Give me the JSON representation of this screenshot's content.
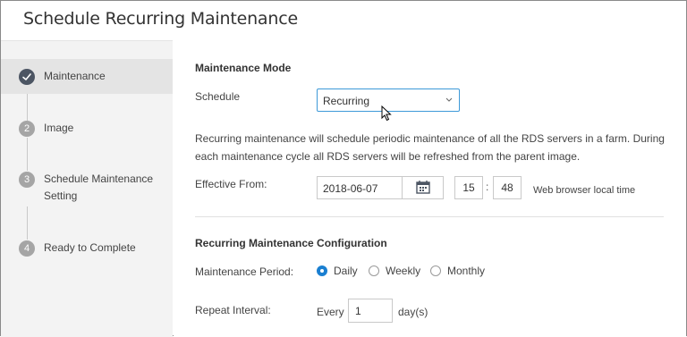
{
  "dialog": {
    "title": "Schedule Recurring Maintenance"
  },
  "steps": [
    {
      "number": "",
      "label": "Maintenance",
      "state": "active"
    },
    {
      "number": "2",
      "label": "Image",
      "state": "pending"
    },
    {
      "number": "3",
      "label": "Schedule Maintenance Setting",
      "state": "pending"
    },
    {
      "number": "4",
      "label": "Ready to Complete",
      "state": "pending"
    }
  ],
  "maintenance_mode": {
    "title": "Maintenance Mode",
    "schedule_label": "Schedule",
    "schedule_value": "Recurring",
    "description": "Recurring maintenance will schedule periodic maintenance of all the RDS servers in a farm. During each maintenance cycle all RDS servers will be refreshed from the parent image.",
    "effective_label": "Effective From:",
    "date_value": "2018-06-07",
    "hour_value": "15",
    "minute_value": "48",
    "time_separator": ":",
    "timezone_note": "Web browser local time"
  },
  "recurring_config": {
    "title": "Recurring Maintenance Configuration",
    "period_label": "Maintenance Period:",
    "period_options": [
      {
        "label": "Daily",
        "checked": true
      },
      {
        "label": "Weekly",
        "checked": false
      },
      {
        "label": "Monthly",
        "checked": false
      }
    ],
    "repeat_label": "Repeat Interval:",
    "every_label": "Every",
    "repeat_value": "1",
    "repeat_unit": "day(s)"
  },
  "colors": {
    "accent": "#1a7fd1",
    "active_step": "#4c5563",
    "pending_step": "#a5a5a5",
    "sidebar_bg": "#f3f3f3"
  },
  "icons": {
    "completed_step": "check-icon",
    "select_chevron": "chevron-down-icon",
    "calendar": "calendar-icon",
    "cursor": "mouse-pointer-icon"
  }
}
